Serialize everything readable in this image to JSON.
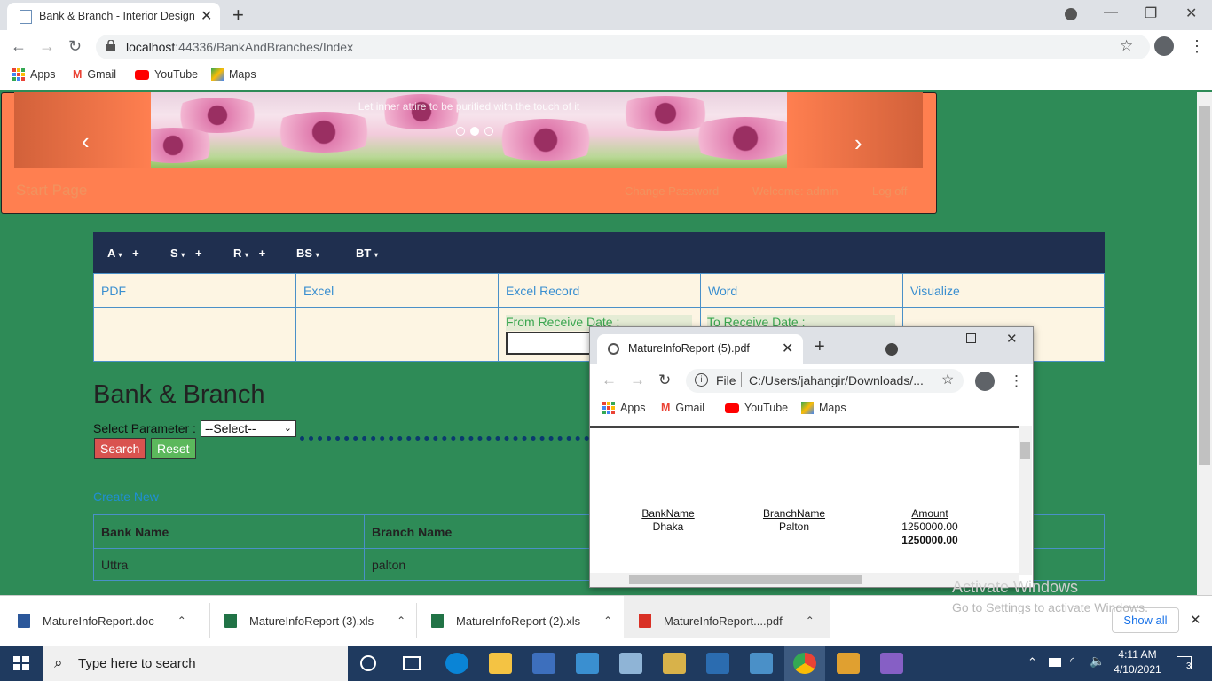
{
  "browser": {
    "tab_title": "Bank & Branch - Interior Design",
    "url_host": "localhost",
    "url_rest": ":44336/BankAndBranches/Index",
    "bookmarks": [
      "Apps",
      "Gmail",
      "YouTube",
      "Maps"
    ]
  },
  "header": {
    "carousel_caption": "Let inner attire to be purified with the touch of it",
    "start_page": "Start Page",
    "change_password": "Change Password",
    "welcome": "Welcome: admin",
    "logoff": "Log off"
  },
  "nav": {
    "items": [
      {
        "label": "A",
        "plus": "+"
      },
      {
        "label": "S",
        "plus": "+"
      },
      {
        "label": "R",
        "plus": "+"
      },
      {
        "label": "BS",
        "plus": ""
      },
      {
        "label": "BT",
        "plus": ""
      }
    ]
  },
  "tools": {
    "pdf": "PDF",
    "excel": "Excel",
    "excel_record": "Excel Record",
    "word": "Word",
    "visualize": "Visualize",
    "from_date": "From Receive Date :",
    "to_date": "To Receive Date :"
  },
  "page": {
    "title": "Bank & Branch",
    "select_label": "Select Parameter :",
    "select_value": "--Select--",
    "search": "Search",
    "reset": "Reset",
    "create_new": "Create New"
  },
  "table": {
    "headers": [
      "Bank Name",
      "Branch Name"
    ],
    "rows": [
      [
        "Uttra",
        "palton"
      ]
    ]
  },
  "popup": {
    "tab_title": "MatureInfoReport (5).pdf",
    "url_scheme": "File",
    "url": "C:/Users/jahangir/Downloads/...",
    "bookmarks": [
      "Apps",
      "Gmail",
      "YouTube",
      "Maps"
    ],
    "report": {
      "headers": [
        "BankName",
        "BranchName",
        "Amount"
      ],
      "row": [
        "Dhaka",
        "Palton",
        "1250000.00"
      ],
      "total": "1250000.00"
    }
  },
  "downloads": {
    "files": [
      "MatureInfoReport.doc",
      "MatureInfoReport (3).xls",
      "MatureInfoReport (2).xls",
      "MatureInfoReport....pdf"
    ],
    "show_all": "Show all"
  },
  "watermark": {
    "line1": "Activate Windows",
    "line2": "Go to Settings to activate Windows."
  },
  "taskbar": {
    "search_placeholder": "Type here to search",
    "time": "4:11 AM",
    "date": "4/10/2021",
    "notifications": "3"
  },
  "colors": {
    "page_bg": "#2e8b57",
    "banner": "#ff7f50",
    "navbar": "#1f2f4f",
    "search_btn": "#d9534f",
    "reset_btn": "#5cb85c",
    "link": "#3a8fd0"
  }
}
